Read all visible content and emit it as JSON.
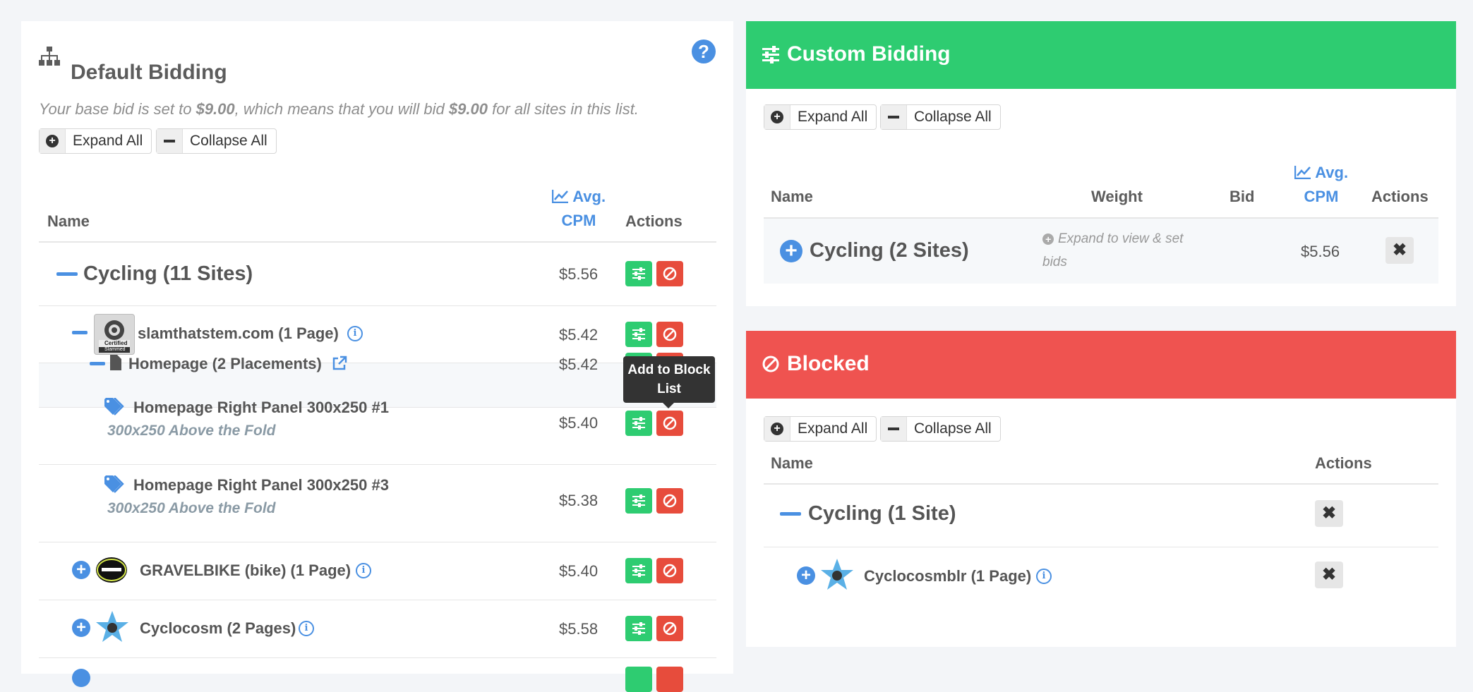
{
  "default_bidding": {
    "title": "Default Bidding",
    "base_bid_prefix": "Your base bid is set to ",
    "base_bid_value": "$9.00",
    "base_bid_middle": ", which means that you will bid ",
    "base_bid_value2": "$9.00",
    "base_bid_suffix": " for all sites in this list.",
    "help_icon": "?",
    "expand_all": "Expand All",
    "collapse_all": "Collapse All",
    "col_name": "Name",
    "col_avg": "Avg.",
    "col_cpm": "CPM",
    "col_actions": "Actions",
    "group_name": "Cycling (11 Sites)",
    "group_price": "$5.56",
    "sites": [
      {
        "name": "slamthatstem.com (1 Page)",
        "price": "$5.42"
      },
      {
        "name": "GRAVELBIKE (bike) (1 Page)",
        "price": "$5.40"
      },
      {
        "name": "Cyclocosm (2 Pages)",
        "price": "$5.58"
      }
    ],
    "page": {
      "name": "Homepage (2 Placements)",
      "price": "$5.42"
    },
    "placements": [
      {
        "name": "Homepage Right Panel 300x250 #1",
        "sub": "300x250 Above the Fold",
        "price": "$5.40"
      },
      {
        "name": "Homepage Right Panel 300x250 #3",
        "sub": "300x250 Above the Fold",
        "price": "$5.38"
      }
    ],
    "thumb_label_1": "Certified",
    "thumb_label_2": "Slammed",
    "tooltip": "Add to Block List"
  },
  "custom_bidding": {
    "title": "Custom Bidding",
    "expand_all": "Expand All",
    "collapse_all": "Collapse All",
    "col_name": "Name",
    "col_weight": "Weight",
    "col_bid": "Bid",
    "col_avg": "Avg.",
    "col_cpm": "CPM",
    "col_actions": "Actions",
    "row_name": "Cycling (2 Sites)",
    "row_note": "Expand to view & set bids",
    "row_price": "$5.56"
  },
  "blocked": {
    "title": "Blocked",
    "expand_all": "Expand All",
    "collapse_all": "Collapse All",
    "col_name": "Name",
    "col_actions": "Actions",
    "group_name": "Cycling (1 Site)",
    "site_name": "Cyclocosmblr (1 Page)"
  },
  "colors": {
    "accent_blue": "#4a90e2",
    "green": "#2ecc71",
    "red": "#e74c3c",
    "custom_header": "#2ecc71",
    "blocked_header": "#ef5350"
  },
  "icons": [
    "sitemap-icon",
    "help-icon",
    "plus-circle-icon",
    "minus-icon",
    "line-chart-icon",
    "sliders-icon",
    "ban-icon",
    "info-icon",
    "file-icon",
    "external-link-icon",
    "tags-icon",
    "times-icon"
  ]
}
